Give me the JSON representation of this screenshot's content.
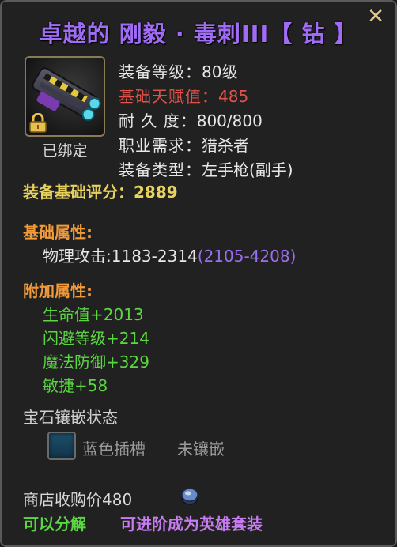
{
  "title": "卓越的 刚毅 · 毒刺III【 钻 】",
  "close_icon": "close-icon",
  "item": {
    "icon": "handgun-icon",
    "lock_icon": "lock-icon",
    "bound_label": "已绑定"
  },
  "stats": {
    "level_label": "装备等级：",
    "level_value": "80级",
    "talent_label": "基础天赋值：",
    "talent_value": "485",
    "durability_label": "耐 久 度：",
    "durability_value": "800/800",
    "class_label": "职业需求：",
    "class_value": "猎杀者",
    "type_label": "装备类型：",
    "type_value": "左手枪(副手)"
  },
  "score": {
    "label": "装备基础评分：",
    "value": "2889"
  },
  "base_attr": {
    "heading": "基础属性:",
    "attack_label": "物理攻击:",
    "attack_value": "1183-2314",
    "attack_range": "(2105-4208)"
  },
  "extra_attr": {
    "heading": "附加属性:",
    "items": [
      {
        "label": "生命值",
        "value": "+2013"
      },
      {
        "label": "闪避等级",
        "value": "+214"
      },
      {
        "label": "魔法防御",
        "value": "+329"
      },
      {
        "label": "敏捷",
        "value": "+58"
      }
    ]
  },
  "gem": {
    "heading": "宝石镶嵌状态",
    "socket_label": "蓝色插槽",
    "socket_status": "未镶嵌",
    "socket_color": "#1f4f6a"
  },
  "shop": {
    "price_label": "商店收购价",
    "price_value": "480",
    "coin_icon": "coin-icon"
  },
  "footer": {
    "disassemble": "可以分解",
    "upgrade": "可进阶成为英雄套装"
  },
  "colors": {
    "title": "#a06cf5",
    "talent": "#e0534a",
    "score": "#e8d25e",
    "section": "#f09a3a",
    "attribute": "#5ad640",
    "range": "#9b6ef0",
    "upgrade": "#c67cf0"
  }
}
